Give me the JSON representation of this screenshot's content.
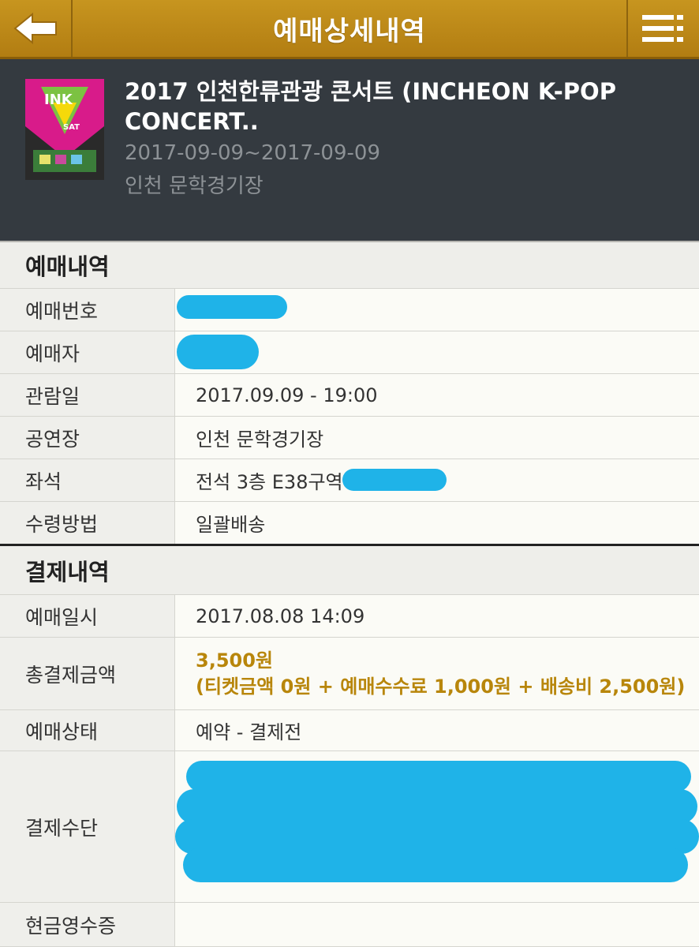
{
  "header": {
    "title": "예매상세내역"
  },
  "event": {
    "title_line1": "2017 인천한류관광 콘서트 (INCHEON K-POP",
    "title_line2": "CONCERT..",
    "date": "2017-09-09~2017-09-09",
    "venue": "인천 문학경기장",
    "poster_logo": "INK",
    "poster_day": "SAT"
  },
  "booking": {
    "section_title": "예매내역",
    "rows": [
      {
        "label": "예매번호",
        "value": ""
      },
      {
        "label": "예매자",
        "value": ""
      },
      {
        "label": "관람일",
        "value": "2017.09.09 - 19:00"
      },
      {
        "label": "공연장",
        "value": "인천 문학경기장"
      },
      {
        "label": "좌석",
        "value": "전석 3층 E38구역"
      },
      {
        "label": "수령방법",
        "value": "일괄배송"
      }
    ]
  },
  "payment": {
    "section_title": "결제내역",
    "booked_at": {
      "label": "예매일시",
      "value": "2017.08.08 14:09"
    },
    "total": {
      "label": "총결제금액",
      "amount": "3,500원",
      "breakdown": "(티켓금액 0원 + 예매수수료 1,000원 + 배송비 2,500원)"
    },
    "status": {
      "label": "예매상태",
      "value": "예약 - 결제전"
    },
    "method": {
      "label": "결제수단",
      "value": ""
    },
    "receipt": {
      "label": "현금영수증",
      "value": ""
    }
  },
  "colors": {
    "header": "#b8861a",
    "panel": "#343a40",
    "price": "#b8860b",
    "scribble": "#1fb3e8"
  }
}
